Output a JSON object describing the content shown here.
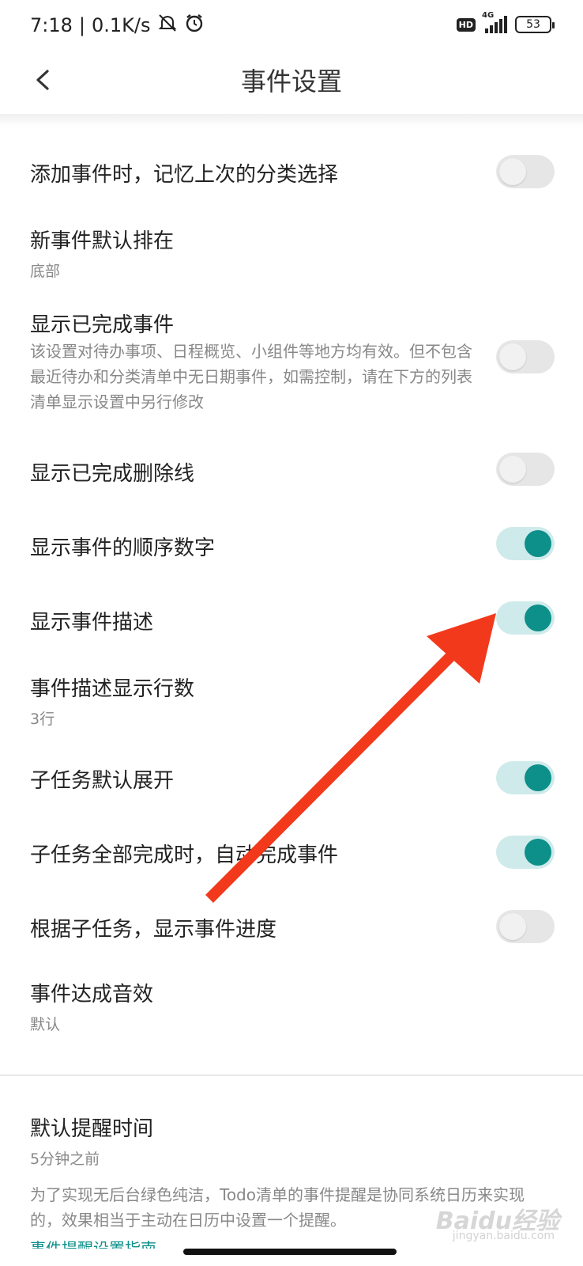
{
  "status_bar": {
    "time": "7:18",
    "separator": "|",
    "speed": "0.1K/s",
    "hd": "HD",
    "network": "4G",
    "battery": "53"
  },
  "app_bar": {
    "title": "事件设置"
  },
  "settings": [
    {
      "title": "添加事件时，记忆上次的分类选择",
      "toggle": "off"
    },
    {
      "title": "新事件默认排在",
      "value": "底部"
    },
    {
      "title": "显示已完成事件",
      "description": "该设置对待办事项、日程概览、小组件等地方均有效。但不包含最近待办和分类清单中无日期事件，如需控制，请在下方的列表清单显示设置中另行修改",
      "toggle": "off"
    },
    {
      "title": "显示已完成删除线",
      "toggle": "off"
    },
    {
      "title": "显示事件的顺序数字",
      "toggle": "on"
    },
    {
      "title": "显示事件描述",
      "toggle": "on"
    },
    {
      "title": "事件描述显示行数",
      "value": "3行"
    },
    {
      "title": "子任务默认展开",
      "toggle": "on"
    },
    {
      "title": "子任务全部完成时，自动完成事件",
      "toggle": "on"
    },
    {
      "title": "根据子任务，显示事件进度",
      "toggle": "off"
    },
    {
      "title": "事件达成音效",
      "value": "默认"
    }
  ],
  "reminder": {
    "title": "默认提醒时间",
    "value": "5分钟之前",
    "description": "为了实现无后台绿色纯洁，Todo清单的事件提醒是协同系统日历来实现的，效果相当于主动在日历中设置一个提醒。",
    "link": "事件提醒设置指南"
  },
  "watermark": {
    "text": "Baidu经验",
    "sub": "jingyan.baidu.com"
  },
  "colors": {
    "accent": "#0d8f8a",
    "toggle_on_track": "#cfeaea",
    "toggle_off_track": "#e6e6e6",
    "annotation_arrow": "#f2391c"
  }
}
